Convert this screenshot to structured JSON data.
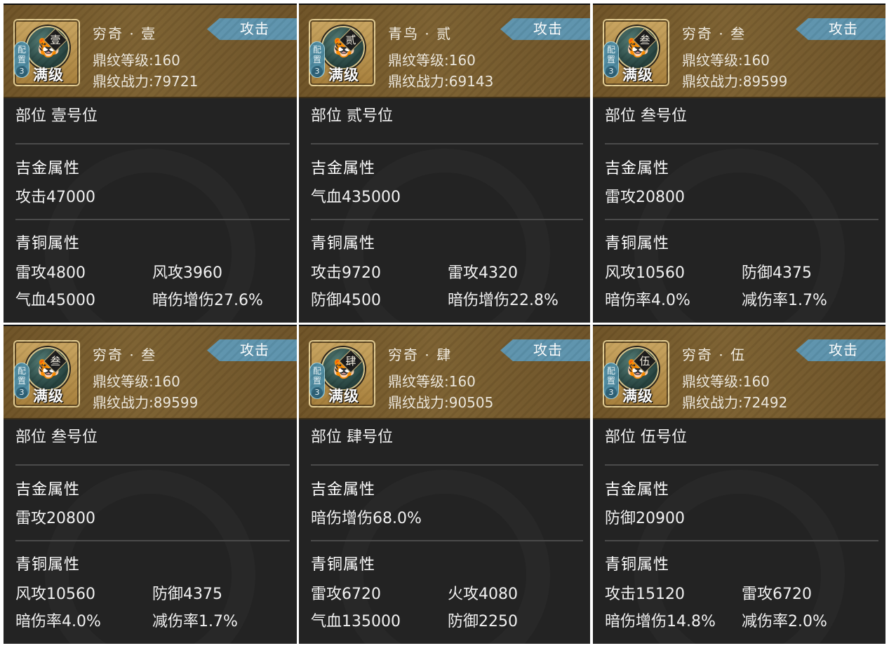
{
  "labels": {
    "slot_prefix": "部位",
    "gold_heading": "吉金属性",
    "bronze_heading": "青铜属性",
    "config_line1": "配",
    "config_line2": "置",
    "config_number": "3",
    "max_level": "满级"
  },
  "cards": [
    {
      "name": "穷奇 · 壹",
      "grade": "壹",
      "level": "鼎纹等级:160",
      "power": "鼎纹战力:79721",
      "type": "攻击",
      "slot": "壹号位",
      "gold": "攻击47000",
      "bronze": [
        "雷攻4800",
        "风攻3960",
        "气血45000",
        "暗伤增伤27.6%"
      ]
    },
    {
      "name": "青鸟 · 贰",
      "grade": "贰",
      "level": "鼎纹等级:160",
      "power": "鼎纹战力:69143",
      "type": "攻击",
      "slot": "贰号位",
      "gold": "气血435000",
      "bronze": [
        "攻击9720",
        "雷攻4320",
        "防御4500",
        "暗伤增伤22.8%"
      ]
    },
    {
      "name": "穷奇 · 叁",
      "grade": "叁",
      "level": "鼎纹等级:160",
      "power": "鼎纹战力:89599",
      "type": "攻击",
      "slot": "叁号位",
      "gold": "雷攻20800",
      "bronze": [
        "风攻10560",
        "防御4375",
        "暗伤率4.0%",
        "减伤率1.7%"
      ]
    },
    {
      "name": "穷奇 · 叁",
      "grade": "叁",
      "level": "鼎纹等级:160",
      "power": "鼎纹战力:89599",
      "type": "攻击",
      "slot": "叁号位",
      "gold": "雷攻20800",
      "bronze": [
        "风攻10560",
        "防御4375",
        "暗伤率4.0%",
        "减伤率1.7%"
      ]
    },
    {
      "name": "穷奇 · 肆",
      "grade": "肆",
      "level": "鼎纹等级:160",
      "power": "鼎纹战力:90505",
      "type": "攻击",
      "slot": "肆号位",
      "gold": "暗伤增伤68.0%",
      "bronze": [
        "雷攻6720",
        "火攻4080",
        "气血135000",
        "防御2250"
      ]
    },
    {
      "name": "穷奇 · 伍",
      "grade": "伍",
      "level": "鼎纹等级:160",
      "power": "鼎纹战力:72492",
      "type": "攻击",
      "slot": "伍号位",
      "gold": "防御20900",
      "bronze": [
        "攻击15120",
        "雷攻6720",
        "暗伤增伤14.8%",
        "减伤率2.0%"
      ]
    }
  ],
  "colors": {
    "header_bronze": "#7c6131",
    "panel_bg": "#232323",
    "tag_blue": "#5d93ad",
    "medallion_teal": "#2c4a46"
  }
}
